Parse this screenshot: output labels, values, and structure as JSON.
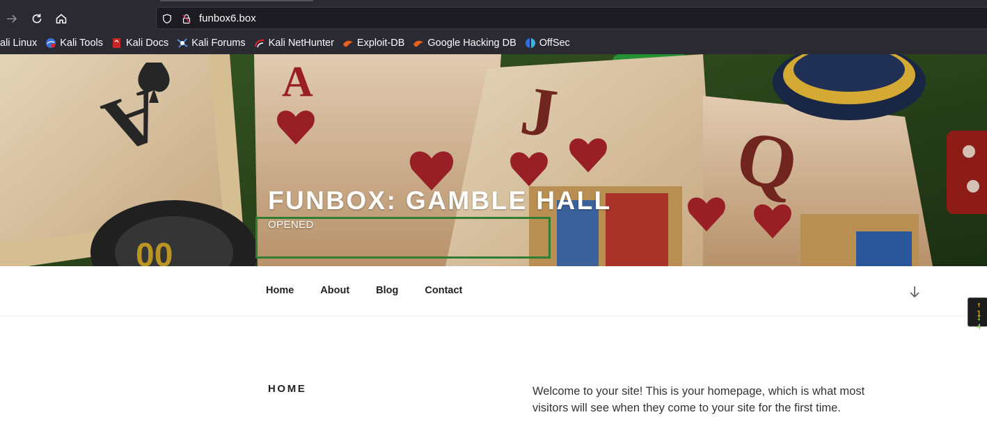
{
  "browser": {
    "url": "funbox6.box",
    "bookmarks": [
      {
        "label": "ali Linux",
        "icon": "kali-icon"
      },
      {
        "label": "Kali Tools",
        "icon": "kali-tools-icon"
      },
      {
        "label": "Kali Docs",
        "icon": "kali-docs-icon"
      },
      {
        "label": "Kali Forums",
        "icon": "kali-forums-icon"
      },
      {
        "label": "Kali NetHunter",
        "icon": "nethunter-icon"
      },
      {
        "label": "Exploit-DB",
        "icon": "exploit-db-icon"
      },
      {
        "label": "Google Hacking DB",
        "icon": "ghdb-icon"
      },
      {
        "label": "OffSec",
        "icon": "offsec-icon"
      }
    ]
  },
  "site": {
    "title": "FUNBOX: GAMBLE HALL",
    "tagline": "OPENED"
  },
  "nav": {
    "items": [
      "Home",
      "About",
      "Blog",
      "Contact"
    ]
  },
  "side_widget": {
    "up": "↑ 1",
    "down": "↓ 4"
  },
  "content": {
    "heading": "HOME",
    "intro": "Welcome to your site! This is your homepage, which is what most visitors will see when they come to your site for the first time."
  },
  "colors": {
    "chrome_bg": "#2b2a33",
    "urlbar_bg": "#1c1b22",
    "highlight_box": "#2e7d32",
    "heading_text": "#222222"
  }
}
